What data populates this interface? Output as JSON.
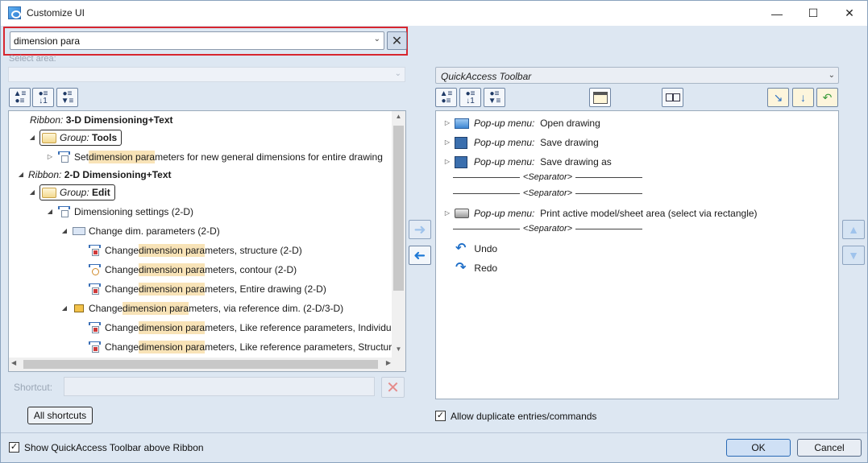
{
  "window": {
    "title": "Customize UI",
    "controls": {
      "minimize": "—",
      "maximize": "☐",
      "close": "✕"
    }
  },
  "search": {
    "value": "dimension para",
    "clear_icon": "clear-x-icon"
  },
  "select_area": {
    "label": "Select area:",
    "value": ""
  },
  "left_toolbar": [
    {
      "name": "expand-all",
      "icon": "tree-expand-icon"
    },
    {
      "name": "sort-ascending",
      "icon": "sort-down-icon"
    },
    {
      "name": "collapse-all",
      "icon": "tree-collapse-icon"
    }
  ],
  "tree": {
    "ribbon1": {
      "prefix": "Ribbon:",
      "name": "3-D Dimensioning+Text"
    },
    "group1": {
      "prefix": "Group:",
      "name": "Tools"
    },
    "item1": {
      "pre": "Set ",
      "hl": "dimension para",
      "post": "meters for new general dimensions for entire drawing"
    },
    "ribbon2": {
      "prefix": "Ribbon:",
      "name": "2-D Dimensioning+Text"
    },
    "group2": {
      "prefix": "Group:",
      "name": "Edit"
    },
    "item2": {
      "text": "Dimensioning settings (2-D)"
    },
    "item3": {
      "text": "Change dim. parameters (2-D)"
    },
    "item4": {
      "pre": "Change ",
      "hl": "dimension para",
      "post": "meters, structure (2-D)"
    },
    "item5": {
      "pre": "Change ",
      "hl": "dimension para",
      "post": "meters, contour (2-D)"
    },
    "item6": {
      "pre": "Change ",
      "hl": "dimension para",
      "post": "meters, Entire drawing (2-D)"
    },
    "item7": {
      "pre": "Change ",
      "hl": "dimension para",
      "post": "meters, via reference dim. (2-D/3-D)"
    },
    "item8": {
      "pre": "Change ",
      "hl": "dimension para",
      "post": "meters, Like reference parameters, Individu"
    },
    "item9": {
      "pre": "Change ",
      "hl": "dimension para",
      "post": "meters, Like reference parameters, Structur"
    }
  },
  "shortcut": {
    "label": "Shortcut:",
    "value": ""
  },
  "all_shortcuts_label": "All shortcuts",
  "show_qa_above_ribbon": {
    "label": "Show QuickAccess Toolbar above Ribbon",
    "checked": true
  },
  "quick_access": {
    "select_value": "QuickAccess Toolbar",
    "items": {
      "open": {
        "prefix": "Pop-up menu:",
        "name": "Open drawing"
      },
      "save": {
        "prefix": "Pop-up menu:",
        "name": "Save drawing"
      },
      "saveas": {
        "prefix": "Pop-up menu:",
        "name": "Save drawing as"
      },
      "sep1": "<Separator>",
      "sep2": "<Separator>",
      "print": {
        "prefix": "Pop-up menu:",
        "name": "Print active model/sheet area (select via rectangle)"
      },
      "sep3": "<Separator>",
      "undo": "Undo",
      "redo": "Redo"
    }
  },
  "allow_duplicates": {
    "label": "Allow duplicate entries/commands",
    "checked": true
  },
  "ok_label": "OK",
  "cancel_label": "Cancel",
  "colors": {
    "highlight": "#f8e3b7",
    "search_frame": "#d7262f",
    "accent": "#2a6ab5"
  }
}
